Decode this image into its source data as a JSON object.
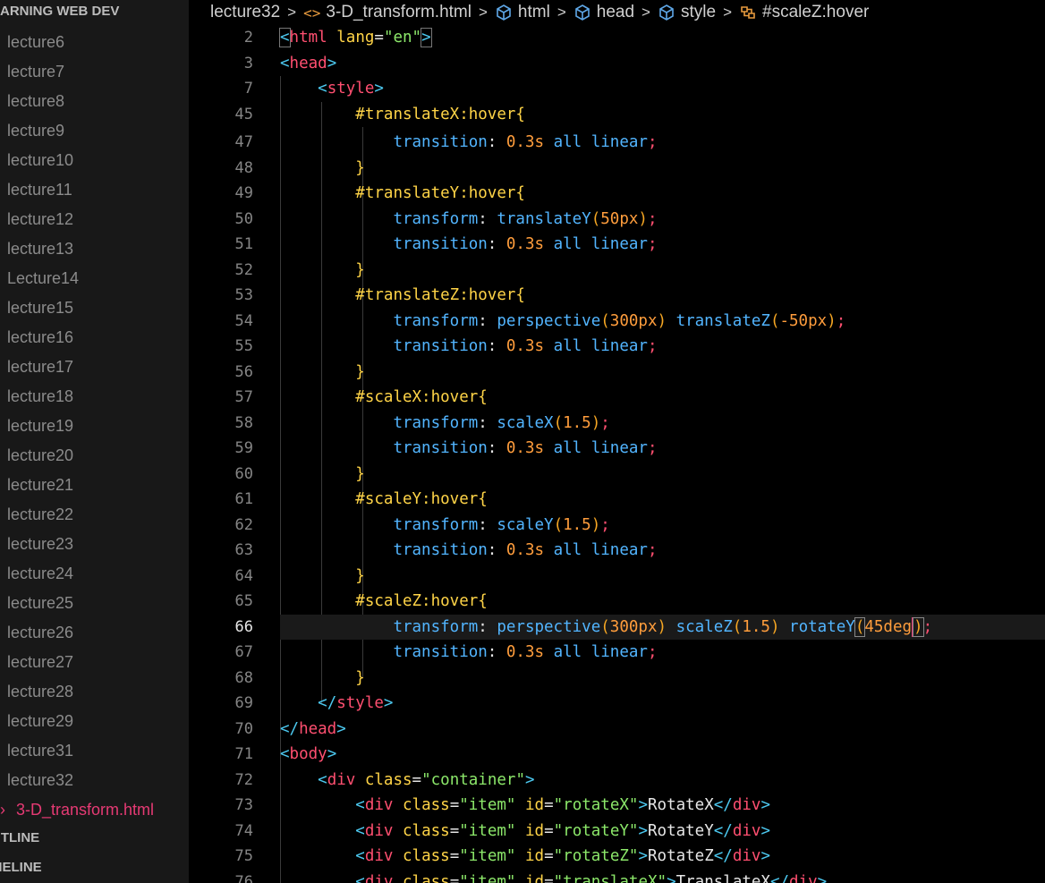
{
  "sidebar": {
    "title": "EARNING WEB DEV",
    "items": [
      "lecture6",
      "lecture7",
      "lecture8",
      "lecture9",
      "lecture10",
      "lecture11",
      "lecture12",
      "lecture13",
      "Lecture14",
      "lecture15",
      "lecture16",
      "lecture17",
      "lecture18",
      "lecture19",
      "lecture20",
      "lecture21",
      "lecture22",
      "lecture23",
      "lecture24",
      "lecture25",
      "lecture26",
      "lecture27",
      "lecture28",
      "lecture29",
      "lecture31",
      "lecture32"
    ],
    "active_file": "3-D_transform.html",
    "outline": "UTLINE",
    "timeline": "MELINE"
  },
  "breadcrumb": {
    "folder": "lecture32",
    "file": "3-D_transform.html",
    "html": "html",
    "head": "head",
    "style": "style",
    "selector": "#scaleZ:hover"
  },
  "editor": {
    "line_numbers": [
      "2",
      "3",
      "7",
      "45",
      "47",
      "48",
      "49",
      "50",
      "51",
      "52",
      "53",
      "54",
      "55",
      "56",
      "57",
      "58",
      "59",
      "60",
      "61",
      "62",
      "63",
      "64",
      "65",
      "66",
      "67",
      "68",
      "69",
      "70",
      "71",
      "72",
      "73",
      "74",
      "75",
      "76"
    ],
    "current_line": "66"
  },
  "colors": {
    "sidebar_bg": "#181818",
    "editor_bg": "#000000",
    "accent_active": "#e63a74"
  }
}
